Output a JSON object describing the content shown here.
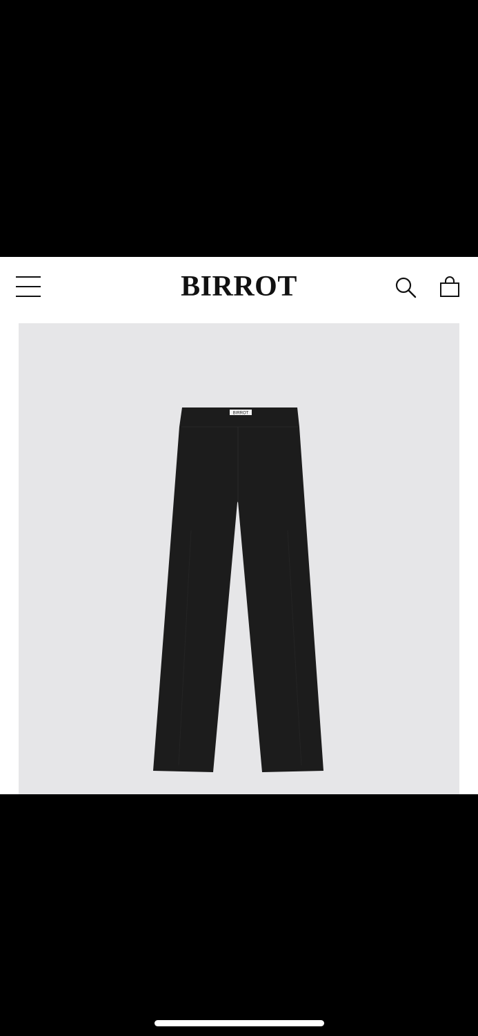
{
  "header": {
    "brand": "BIRROT",
    "menu_icon": "hamburger-menu-icon",
    "search_icon": "search-icon",
    "bag_icon": "shopping-bag-icon"
  },
  "product": {
    "image_description_icon": "trousers-image",
    "waist_label_text": "BIRROT",
    "colors": {
      "background": "#e6e6e8",
      "garment": "#1c1c1c"
    }
  }
}
